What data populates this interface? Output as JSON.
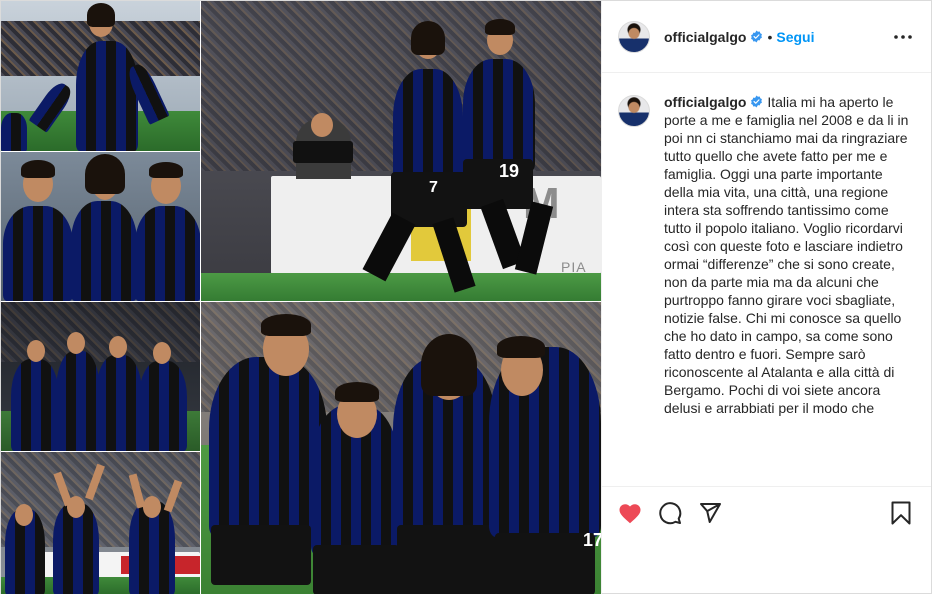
{
  "post": {
    "account": {
      "username": "officialgalgo",
      "verified": true
    },
    "header": {
      "separator": "•",
      "follow_label": "Segui",
      "more_icon": "more-horizontal-icon"
    },
    "caption": {
      "username": "officialgalgo",
      "text": "Italia mi ha aperto le porte a me e famiglia nel 2008 e da li in poi nn ci stanchiamo mai da ringraziare tutto quello che avete fatto per me e famiglia. Oggi una parte importante della mia vita, una città, una regione intera sta soffrendo tantissimo come tutto il popolo italiano. Voglio ricordarvi così con queste foto e lasciare indietro ormai “differenze” che si sono create, non da parte mia ma da alcuni che purtroppo fanno girare voci sbagliate, notizie false. Chi mi conosce sa quello che ho dato in campo, sa come sono fatto dentro e fuori. Sempre sarò riconoscente al Atalanta e alla città di Bergamo. Pochi di voi siete ancora delusi e arrabbiati per il modo che"
    },
    "actions": {
      "like_icon": "heart-filled-icon",
      "like_color": "#ed4956",
      "comment_icon": "comment-icon",
      "share_icon": "send-icon",
      "save_icon": "bookmark-icon"
    },
    "colors": {
      "follow": "#0095f6",
      "verified": "#3897f0",
      "text": "#262626"
    },
    "collage": {
      "photos": [
        {
          "name": "photo-celebration-arms-wide"
        },
        {
          "name": "photo-goal-celebration-7-and-19"
        },
        {
          "name": "photo-three-players-close"
        },
        {
          "name": "photo-night-team-huddle"
        },
        {
          "name": "photo-four-players-group"
        },
        {
          "name": "photo-team-celebrating-arms-up"
        }
      ],
      "jersey_numbers": [
        "7",
        "19",
        "17"
      ],
      "banner_text": "M",
      "banner_text_2": "PIA"
    }
  }
}
